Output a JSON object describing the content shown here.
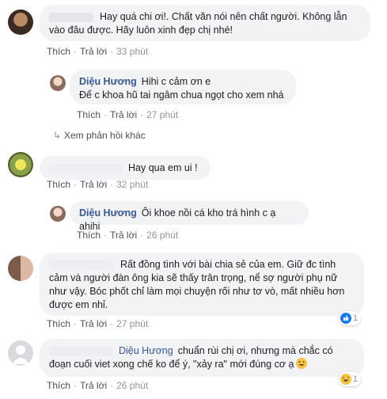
{
  "comments": [
    {
      "text": "Hay quá chi ơi!. Chất văn nói nên chất người. Không lẫn vào đâu được. Hãy luôn xinh đẹp chị nhé!",
      "line1": "Hay quá chi ơi!. Chất văn nói nên chất người. Không lẫn",
      "line2": "vào đâu được. Hãy luôn xinh đẹp chị nhé!",
      "like": "Thích",
      "reply": "Trả lời",
      "time": "33 phút"
    },
    {
      "author": "Diệu Hương",
      "line1": "Hihi c cảm ơn e",
      "line2": "Để c khoa hũ tai ngâm chua ngọt cho xem nhá",
      "like": "Thích",
      "reply": "Trả lời",
      "time": "27 phút"
    },
    {
      "text": "Hay qua em ui !",
      "like": "Thích",
      "reply": "Trả lời",
      "time": "32 phút"
    },
    {
      "author": "Diệu Hương",
      "text": "Ôi khoe nồi cá kho trá hình c ạ ahihi",
      "like": "Thích",
      "reply": "Trả lời",
      "time": "26 phút"
    },
    {
      "line1": "Rất đồng tình với bài chia sẻ của em. Giữ đc tình",
      "line2": "cảm và người đàn ông kia sẽ thấy trân trọng, nể sợ người phụ nữ",
      "line3": "như vậy. Bóc phốt chỉ làm mọi chuyện rối như tơ vò, mất nhiều hơn",
      "line4": "được em nhỉ.",
      "like": "Thích",
      "reply": "Trả lời",
      "time": "27 phút",
      "reaction_count": "1"
    },
    {
      "tag": "Diệu Hương",
      "line1": "chuẩn rùi chị ơi, nhưng mà chắc có",
      "line2": "đoạn cuối viet xong chế ko để ý, \"xảy ra\" mới đúng cơ ạ",
      "like": "Thích",
      "reply": "Trả lời",
      "time": "26 phút",
      "reaction_count": "1"
    }
  ],
  "more_replies": "Xem phản hồi khác",
  "icons": {
    "reply_arrow": "reply-arrow-icon",
    "like": "like-reaction-icon",
    "haha": "haha-reaction-icon",
    "emoji": "grinning-emoji-icon"
  },
  "colors": {
    "name": "#385898",
    "bubble": "#f2f3f5",
    "like_blue": "#1877f2"
  }
}
